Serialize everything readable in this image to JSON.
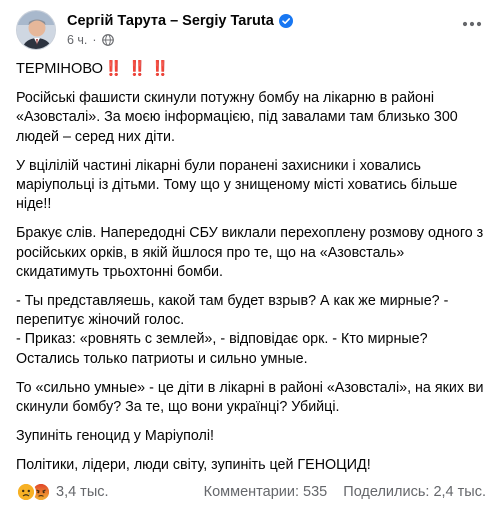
{
  "post": {
    "author": "Сергій Тарута – Sergiy Taruta",
    "time": "6 ч.",
    "dot": "·",
    "title": "ТЕРМІНОВО",
    "bangs": [
      "‼️",
      "‼️",
      "‼️"
    ],
    "paragraphs": [
      "Російські фашисти скинули потужну бомбу на лікарню в районі «Азовсталі». За моєю інформацією, під завалами там близько 300 людей – серед них діти.",
      "У вцілілій частині лікарні були поранені захисники і ховались маріупольці із дітьми. Тому що у знищеному місті ховатись більше ніде!!",
      "Бракує слів. Напередодні СБУ виклали перехоплену розмову одного з російських орків, в якій йшлося про те, що на «Азовсталь» скидатимуть трьохтонні бомби.",
      "- Ты представляешь, какой там будет взрыв? А как же мирные? - перепитує жіночий голос.\n- Приказ: «ровнять с землей», - відповідає орк. - Кто мирные? Остались только патриоты и сильно умные.",
      "То «сильно умные» - це діти в лікарні в районі «Азовсталі», на яких ви скинули бомбу? За те, що вони українці? Убийці.",
      "Зупиніть геноцид у Маріуполі!",
      "Політики, лідери, люди світу, зупиніть цей ГЕНОЦИД!"
    ],
    "reactions_count": "3,4 тыс.",
    "comments": "Комментарии: 535",
    "shares": "Поделились: 2,4 тыс."
  },
  "icons": {
    "verified": "verified-badge-icon",
    "privacy": "globe-icon",
    "more": "more-options-icon",
    "reactions": [
      "sad-reaction-icon",
      "angry-reaction-icon"
    ]
  },
  "colors": {
    "text": "#050505",
    "secondary": "#65676b",
    "verified": "#1877f2",
    "bang": "#e0241b",
    "sad": "#f7b125",
    "angry": "#e9710f"
  }
}
